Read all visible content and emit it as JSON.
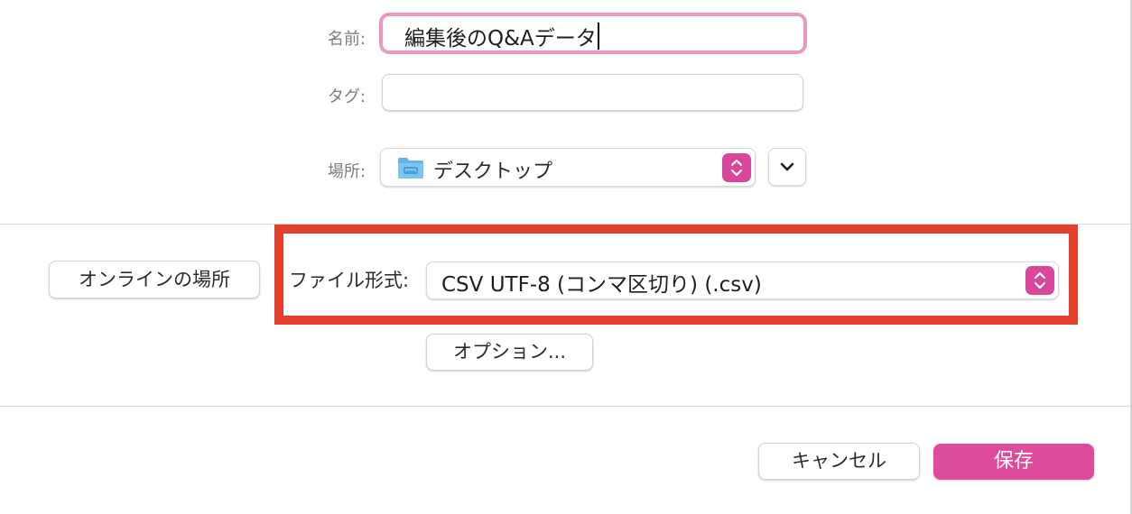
{
  "dialog": {
    "name_label": "名前:",
    "name_value": "編集後のQ&Aデータ",
    "tag_label": "タグ:",
    "tag_value": "",
    "location_label": "場所:",
    "location_value": "デスクトップ",
    "online_button": "オンラインの場所",
    "format_label": "ファイル形式:",
    "format_value": "CSV UTF-8 (コンマ区切り) (.csv)",
    "options_button": "オプション...",
    "cancel_button": "キャンセル",
    "save_button": "保存"
  },
  "icons": {
    "folder": "folder-icon",
    "stepper": "up-down-chevron-icon",
    "expand": "chevron-down-icon"
  },
  "colors": {
    "accent": "#dc4b9c",
    "focus_ring": "#e69ac2",
    "highlight_box": "#e5402b",
    "folder_blue": "#62b2e8"
  }
}
